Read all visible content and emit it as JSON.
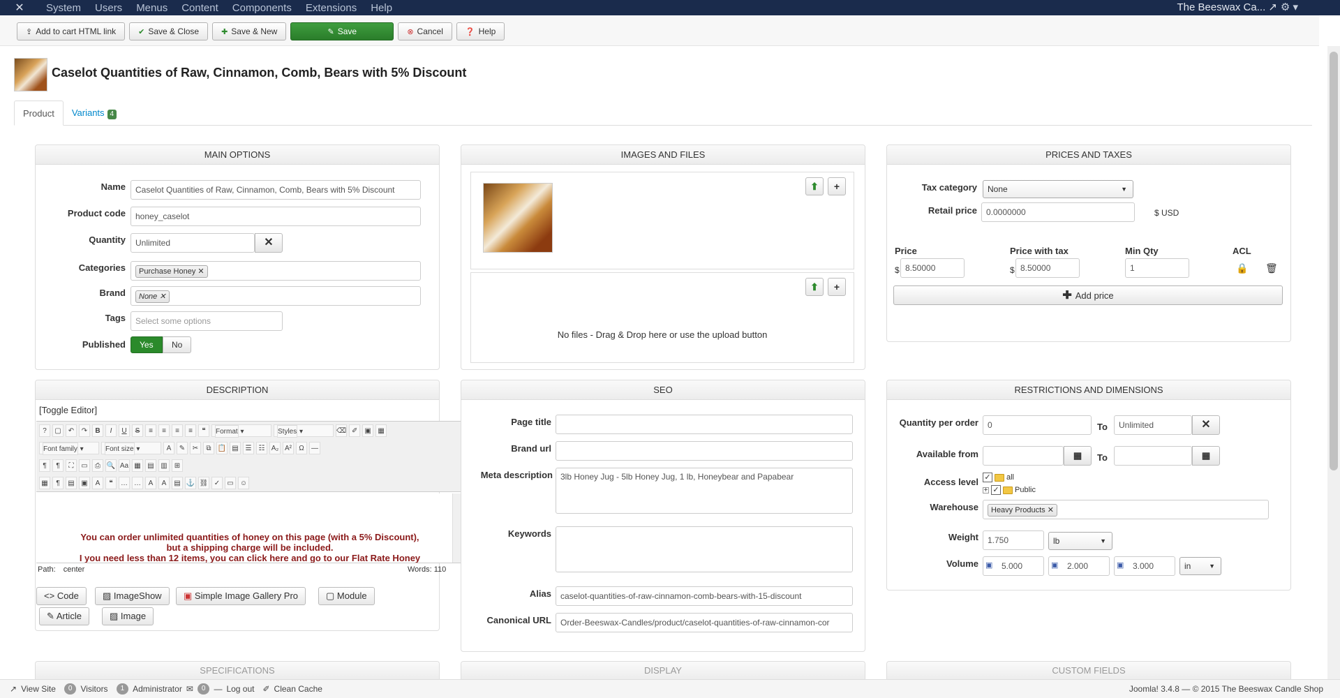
{
  "topnav": {
    "menu": [
      "System",
      "Users",
      "Menus",
      "Content",
      "Components",
      "Extensions",
      "Help"
    ],
    "site_name": "The Beeswax Ca..."
  },
  "toolbar": {
    "add_to_cart": "Add to cart HTML link",
    "save_close": "Save & Close",
    "save_new": "Save & New",
    "save": "Save",
    "cancel": "Cancel",
    "help": "Help"
  },
  "page": {
    "title": "Caselot Quantities of Raw, Cinnamon, Comb, Bears with 5% Discount"
  },
  "tabs": [
    {
      "label": "Product"
    },
    {
      "label": "Variants",
      "badge": "4"
    }
  ],
  "main_options": {
    "heading": "MAIN OPTIONS",
    "name_label": "Name",
    "name_value": "Caselot Quantities of Raw, Cinnamon, Comb, Bears with 5% Discount",
    "code_label": "Product code",
    "code_value": "honey_caselot",
    "quantity_label": "Quantity",
    "quantity_value": "Unlimited",
    "categories_label": "Categories",
    "category_chip": "Purchase Honey",
    "brand_label": "Brand",
    "brand_chip": "None",
    "tags_label": "Tags",
    "tags_placeholder": "Select some options",
    "published_label": "Published",
    "yes": "Yes",
    "no": "No"
  },
  "images": {
    "heading": "IMAGES AND FILES",
    "no_files": "No files - Drag & Drop here or use the upload button"
  },
  "prices": {
    "heading": "PRICES AND TAXES",
    "tax_label": "Tax category",
    "tax_value": "None",
    "retail_label": "Retail price",
    "retail_value": "0.0000000",
    "currency": "$ USD",
    "col_price": "Price",
    "col_price_tax": "Price with tax",
    "col_min_qty": "Min Qty",
    "col_acl": "ACL",
    "dollar": "$",
    "price_value": "8.50000",
    "price_tax_value": "8.50000",
    "min_qty_value": "1",
    "add_price": "Add price"
  },
  "description": {
    "heading": "DESCRIPTION",
    "toggle": "[Toggle Editor]",
    "format": "Format",
    "styles": "Styles",
    "font_family": "Font family",
    "font_size": "Font size",
    "line1": "You can order unlimited quantities of honey on this page (with a 5% Discount),",
    "line2": "but a shipping charge will be included.",
    "line3": "I you need less than 12 items, you can click here and go to our Flat Rate Honey",
    "path": "Path:",
    "path_value": "center",
    "words": "Words: 110",
    "btn_code": "Code",
    "btn_imageshow": "ImageShow",
    "btn_gallery": "Simple Image Gallery Pro",
    "btn_module": "Module",
    "btn_article": "Article",
    "btn_image": "Image"
  },
  "seo": {
    "heading": "SEO",
    "page_title_label": "Page title",
    "brand_url_label": "Brand url",
    "meta_label": "Meta description",
    "meta_value": "3lb Honey Jug - 5lb Honey Jug, 1 lb, Honeybear and Papabear",
    "keywords_label": "Keywords",
    "alias_label": "Alias",
    "alias_value": "caselot-quantities-of-raw-cinnamon-comb-bears-with-15-discount",
    "canonical_label": "Canonical URL",
    "canonical_value": "Order-Beeswax-Candles/product/caselot-quantities-of-raw-cinnamon-cor"
  },
  "restrictions": {
    "heading": "RESTRICTIONS AND DIMENSIONS",
    "qty_order_label": "Quantity per order",
    "qty_min": "0",
    "to": "To",
    "qty_max": "Unlimited",
    "available_label": "Available from",
    "access_label": "Access level",
    "access_all": "all",
    "access_public": "Public",
    "warehouse_label": "Warehouse",
    "warehouse_chip": "Heavy Products",
    "weight_label": "Weight",
    "weight_value": "1.750",
    "weight_unit": "lb",
    "volume_label": "Volume",
    "vol_1": "5.000",
    "vol_2": "2.000",
    "vol_3": "3.000",
    "vol_unit": "in"
  },
  "bottom_sections": [
    "SPECIFICATIONS",
    "DISPLAY",
    "CUSTOM FIELDS"
  ],
  "footer": {
    "view_site": "View Site",
    "visitors_count": "0",
    "visitors": "Visitors",
    "admin_count": "1",
    "admin": "Administrator",
    "msg_count": "0",
    "logout": "Log out",
    "clean_cache": "Clean Cache",
    "copyright": "Joomla! 3.4.8 — © 2015 The Beeswax Candle Shop"
  }
}
